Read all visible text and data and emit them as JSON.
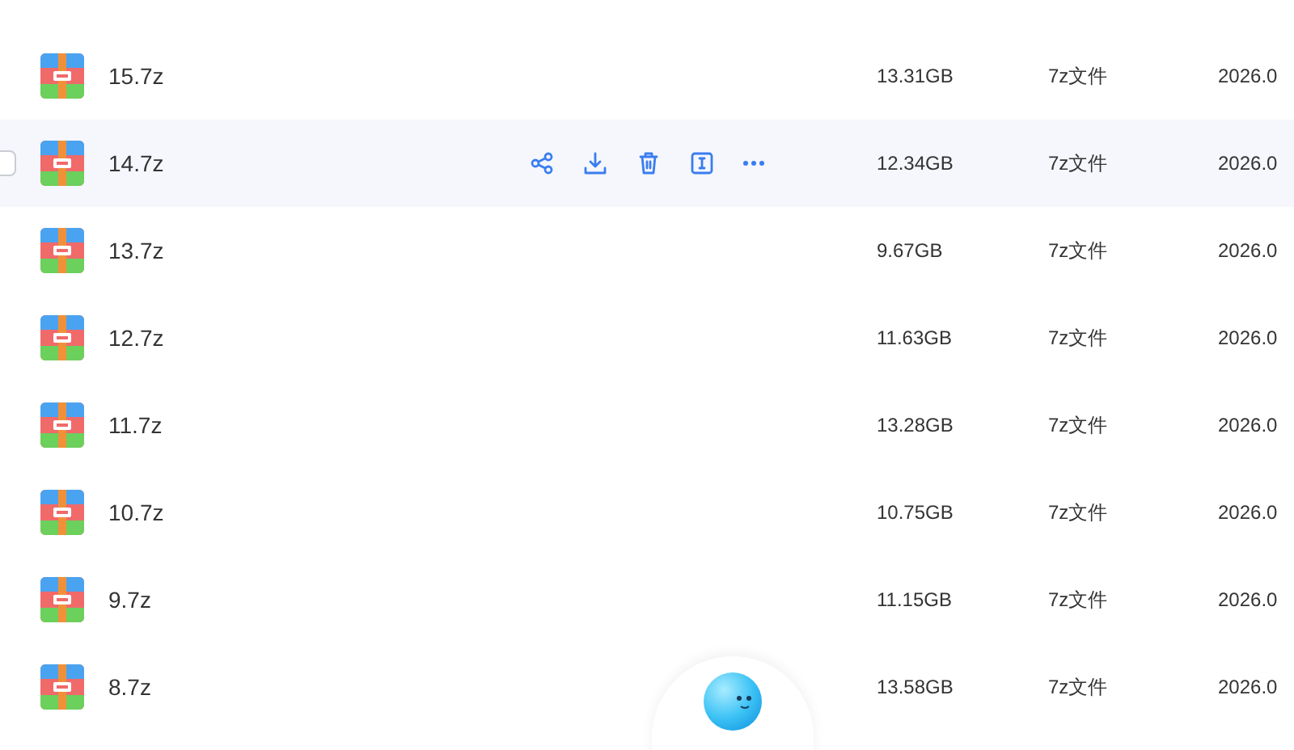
{
  "files": [
    {
      "name": "15.7z",
      "size": "13.31GB",
      "type": "7z文件",
      "date": "2026.0",
      "hovered": false
    },
    {
      "name": "14.7z",
      "size": "12.34GB",
      "type": "7z文件",
      "date": "2026.0",
      "hovered": true
    },
    {
      "name": "13.7z",
      "size": "9.67GB",
      "type": "7z文件",
      "date": "2026.0",
      "hovered": false
    },
    {
      "name": "12.7z",
      "size": "11.63GB",
      "type": "7z文件",
      "date": "2026.0",
      "hovered": false
    },
    {
      "name": "11.7z",
      "size": "13.28GB",
      "type": "7z文件",
      "date": "2026.0",
      "hovered": false
    },
    {
      "name": "10.7z",
      "size": "10.75GB",
      "type": "7z文件",
      "date": "2026.0",
      "hovered": false
    },
    {
      "name": "9.7z",
      "size": "11.15GB",
      "type": "7z文件",
      "date": "2026.0",
      "hovered": false
    },
    {
      "name": "8.7z",
      "size": "13.58GB",
      "type": "7z文件",
      "date": "2026.0",
      "hovered": false
    }
  ]
}
